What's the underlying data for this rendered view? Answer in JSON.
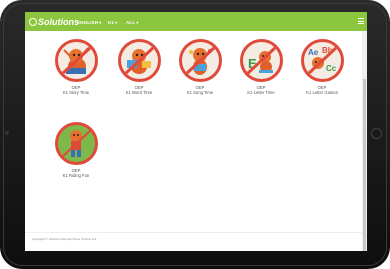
{
  "header": {
    "logo_text": "Solutions",
    "nav": [
      {
        "label": "ENGLISH",
        "caret": "▾"
      },
      {
        "label": "K1",
        "caret": "▾"
      },
      {
        "label": "ALL",
        "caret": "▾"
      }
    ],
    "menu_icon": "hamburger-icon"
  },
  "tiles": [
    {
      "title": "OEP",
      "subtitle": "K1 Story Time",
      "icon": "fox-story-icon"
    },
    {
      "title": "OEP",
      "subtitle": "K1 Word Time",
      "icon": "fox-word-icon"
    },
    {
      "title": "OEP",
      "subtitle": "K1 Song Time",
      "icon": "fox-song-icon"
    },
    {
      "title": "OEP",
      "subtitle": "K1 Letter Time",
      "icon": "fox-letter-icon"
    },
    {
      "title": "OEP",
      "subtitle": "K1 Letter Games",
      "icon": "fox-abc-icon"
    },
    {
      "title": "OEP",
      "subtitle": "K1 Riding Fun",
      "icon": "fox-riding-icon"
    }
  ],
  "footer": {
    "copyright": "Copyright © Oxford University Press (China) Ltd."
  },
  "colors": {
    "topbar": "#8cc63e",
    "circle_border": "#e04a3a",
    "tablet_frame": "#1a1a1a"
  }
}
